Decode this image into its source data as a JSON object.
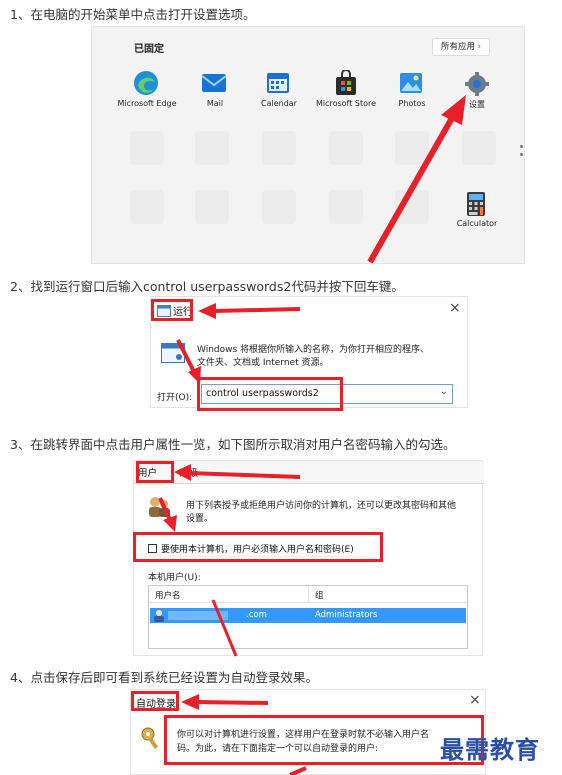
{
  "steps": {
    "s1": "1、在电脑的开始菜单中点击打开设置选项。",
    "s2": "2、找到运行窗口后输入control userpasswords2代码并按下回车键。",
    "s3": "3、在跳转界面中点击用户属性一览，如下图所示取消对用户名密码输入的勾选。",
    "s4": "4、点击保存后即可看到系统已经设置为自动登录效果。"
  },
  "start_menu": {
    "pinned_title": "已固定",
    "all_apps": "所有应用",
    "apps": [
      "Microsoft Edge",
      "Mail",
      "Calendar",
      "Microsoft Store",
      "Photos",
      "设置"
    ],
    "calculator": "Calculator"
  },
  "run_dialog": {
    "title": "运行",
    "description_line1": "Windows 将根据你所输入的名称，为你打开相应的程序、",
    "description_line2": "文件夹、文档或 Internet 资源。",
    "open_label": "打开(O):",
    "command": "control userpasswords2",
    "close": "×"
  },
  "user_accounts": {
    "tab_users": "用户",
    "tab_advanced": "高级",
    "description_line1": "用下列表授予或拒绝用户访问你的计算机，还可以更改其密码和其他",
    "description_line2": "设置。",
    "checkbox_label": "要使用本计算机，用户必须输入用户名和密码(E)",
    "local_users_label": "本机用户(U):",
    "col_username": "用户名",
    "col_group": "组",
    "row_user": ".com",
    "row_group": "Administrators"
  },
  "auto_login": {
    "title": "自动登录",
    "close": "×",
    "description_line1": "你可以对计算机进行设置，这样用户在登录时就不必输入用户名",
    "description_line2": "码。为此，请在下面指定一个可以自动登录的用户:"
  },
  "watermark": "最需教育",
  "colors": {
    "accent_red": "#e8202a",
    "select_blue": "#3399ff"
  }
}
